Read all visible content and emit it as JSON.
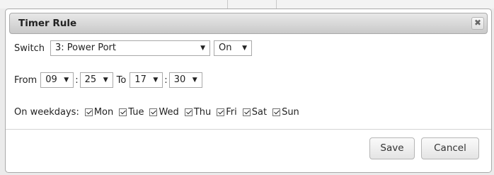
{
  "dialog": {
    "title": "Timer Rule",
    "close_icon": "✖",
    "switch_label": "Switch",
    "switch_value": "3: Power Port",
    "state_value": "On",
    "from_label": "From",
    "from_hour": "09",
    "from_minute": "25",
    "to_label": "To",
    "to_hour": "17",
    "to_minute": "30",
    "time_separator": ":",
    "weekdays_label": "On weekdays:",
    "days": [
      "Mon",
      "Tue",
      "Wed",
      "Thu",
      "Fri",
      "Sat",
      "Sun"
    ],
    "save_label": "Save",
    "cancel_label": "Cancel"
  }
}
